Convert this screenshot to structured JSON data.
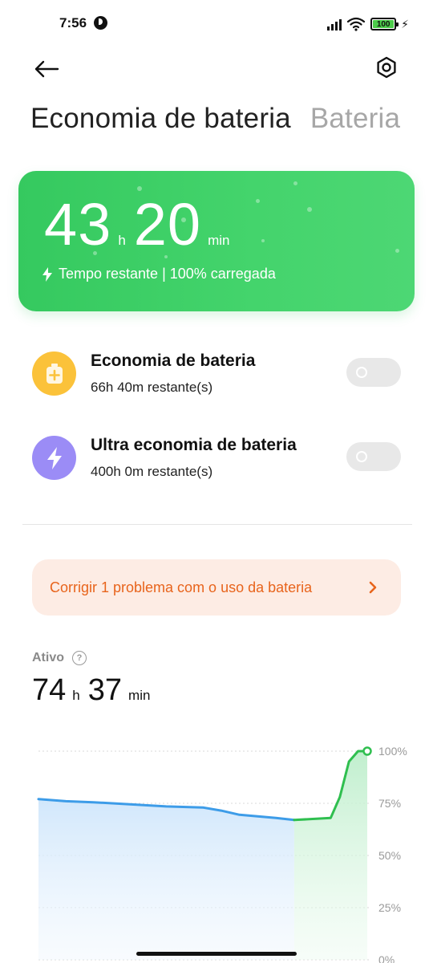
{
  "status_bar": {
    "time": "7:56",
    "battery_level": "100",
    "battery_color": "#4ccb4a",
    "icons": [
      "app-notification-icon",
      "signal-icon",
      "wifi-icon",
      "battery-icon",
      "charging-bolt-icon"
    ]
  },
  "header": {
    "back_icon": "arrow-left-icon",
    "settings_icon": "gear-icon",
    "tabs": [
      {
        "label": "Economia de bateria",
        "active": true
      },
      {
        "label": "Bateria",
        "active": false
      }
    ]
  },
  "hero": {
    "hours": "43",
    "hours_unit": "h",
    "minutes": "20",
    "minutes_unit": "min",
    "subtitle": "Tempo restante | 100% carregada",
    "accent": "#3fcf66"
  },
  "options": [
    {
      "title": "Economia de bateria",
      "subtitle": "66h 40m restante(s)",
      "icon": "battery-plus-icon",
      "icon_color": "#fbc23a",
      "enabled": false
    },
    {
      "title": "Ultra economia de bateria",
      "subtitle": "400h 0m restante(s)",
      "icon": "bolt-icon",
      "icon_color": "#9b8cf6",
      "enabled": false
    }
  ],
  "warning": {
    "text": "Corrigir 1 problema com o uso da bateria",
    "color": "#e8641c",
    "background": "#fdece4"
  },
  "active": {
    "label": "Ativo",
    "hours": "74",
    "hours_unit": "h",
    "minutes": "37",
    "minutes_unit": "min"
  },
  "chart_data": {
    "type": "area",
    "y_ticks": [
      "100%",
      "75%",
      "50%",
      "25%",
      "0%"
    ],
    "ylim": [
      0,
      100
    ],
    "series": [
      {
        "name": "",
        "color": "#3d9ce8",
        "points": [
          [
            0,
            77
          ],
          [
            3,
            76
          ],
          [
            6,
            75.5
          ],
          [
            10,
            74.5
          ],
          [
            14,
            73.5
          ],
          [
            18,
            73
          ],
          [
            20,
            71.5
          ],
          [
            22,
            69.5
          ],
          [
            26,
            68
          ],
          [
            28,
            67
          ]
        ]
      },
      {
        "name": "",
        "color": "#2fbf4f",
        "points": [
          [
            28,
            67
          ],
          [
            32,
            68
          ],
          [
            33,
            78
          ],
          [
            34,
            95
          ],
          [
            35,
            100
          ],
          [
            36,
            100
          ]
        ]
      }
    ],
    "xlim": [
      0,
      36
    ]
  }
}
